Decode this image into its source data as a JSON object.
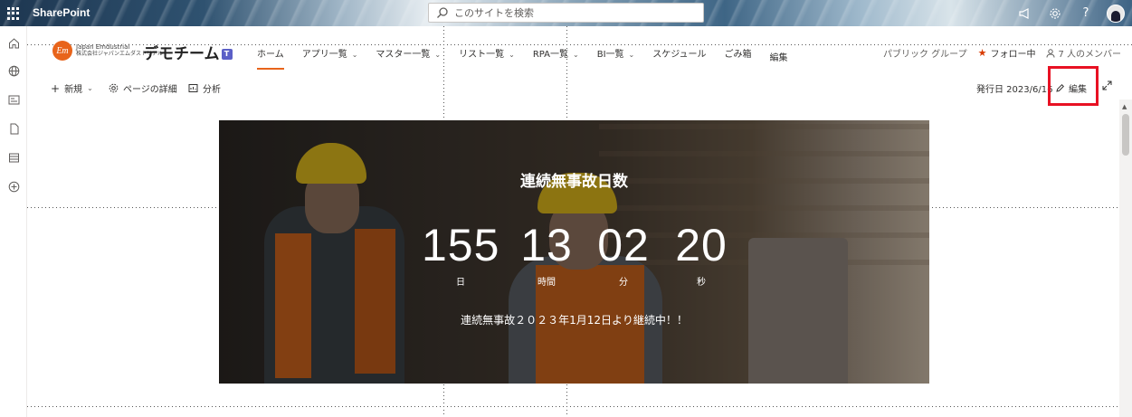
{
  "suitebar": {
    "app_name": "SharePoint",
    "search_placeholder": "このサイトを検索"
  },
  "site": {
    "title": "デモチーム",
    "logo_initials": "Em",
    "logo_name": "Japan Emdustrial",
    "logo_sub": "株式会社ジャパンエムダストリアル"
  },
  "nav": {
    "items": [
      {
        "label": "ホーム",
        "dropdown": false,
        "active": true
      },
      {
        "label": "アプリ一覧",
        "dropdown": true
      },
      {
        "label": "マスター一覧",
        "dropdown": true
      },
      {
        "label": "リスト一覧",
        "dropdown": true
      },
      {
        "label": "RPA一覧",
        "dropdown": true
      },
      {
        "label": "BI一覧",
        "dropdown": true
      },
      {
        "label": "スケジュール",
        "dropdown": false
      },
      {
        "label": "ごみ箱",
        "dropdown": false
      },
      {
        "label": "編集",
        "dropdown": false
      }
    ]
  },
  "header_right": {
    "group": "パブリック グループ",
    "follow": "フォロー中",
    "members": "7 人のメンバー"
  },
  "command_bar": {
    "new": "新規",
    "page_details": "ページの詳細",
    "analytics": "分析",
    "published": "発行日 2023/6/16",
    "edit": "編集"
  },
  "hero": {
    "title": "連続無事故日数",
    "days": "155",
    "hours": "13",
    "minutes": "02",
    "seconds": "20",
    "days_unit": "日",
    "hours_unit": "時間",
    "minutes_unit": "分",
    "seconds_unit": "秒",
    "subtitle": "連続無事故２０２３年1月12日より継続中！！"
  },
  "colors": {
    "accent": "#e8641b",
    "highlight": "#e81123",
    "follow_star": "#d83b01"
  }
}
